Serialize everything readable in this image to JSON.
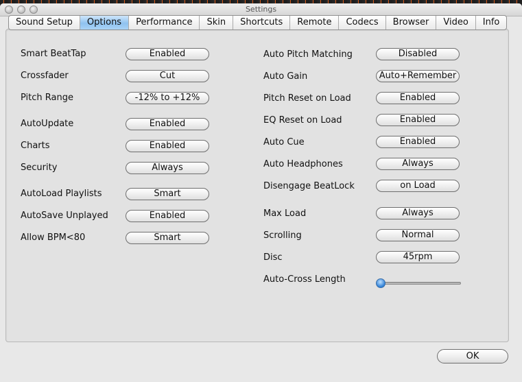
{
  "window": {
    "title": "Settings"
  },
  "tabs": [
    {
      "label": "Sound Setup",
      "active": false
    },
    {
      "label": "Options",
      "active": true
    },
    {
      "label": "Performance",
      "active": false
    },
    {
      "label": "Skin",
      "active": false
    },
    {
      "label": "Shortcuts",
      "active": false
    },
    {
      "label": "Remote",
      "active": false
    },
    {
      "label": "Codecs",
      "active": false
    },
    {
      "label": "Browser",
      "active": false
    },
    {
      "label": "Video",
      "active": false
    },
    {
      "label": "Info",
      "active": false
    }
  ],
  "left_options": [
    {
      "label": "Smart BeatTap",
      "value": "Enabled"
    },
    {
      "label": "Crossfader",
      "value": "Cut"
    },
    {
      "label": "Pitch Range",
      "value": "-12% to +12%"
    },
    {
      "label": "AutoUpdate",
      "value": "Enabled"
    },
    {
      "label": "Charts",
      "value": "Enabled"
    },
    {
      "label": "Security",
      "value": "Always"
    },
    {
      "label": "AutoLoad Playlists",
      "value": "Smart"
    },
    {
      "label": "AutoSave Unplayed",
      "value": "Enabled"
    },
    {
      "label": "Allow BPM<80",
      "value": "Smart"
    }
  ],
  "right_options": [
    {
      "label": "Auto Pitch Matching",
      "value": "Disabled"
    },
    {
      "label": "Auto Gain",
      "value": "Auto+Remember"
    },
    {
      "label": "Pitch Reset on Load",
      "value": "Enabled"
    },
    {
      "label": "EQ Reset on Load",
      "value": "Enabled"
    },
    {
      "label": "Auto Cue",
      "value": "Enabled"
    },
    {
      "label": "Auto Headphones",
      "value": "Always"
    },
    {
      "label": "Disengage BeatLock",
      "value": "on Load"
    },
    {
      "label": "Max Load",
      "value": "Always"
    },
    {
      "label": "Scrolling",
      "value": "Normal"
    },
    {
      "label": "Disc",
      "value": "45rpm"
    }
  ],
  "slider": {
    "label": "Auto-Cross Length",
    "value_fraction": 0.0
  },
  "footer": {
    "ok_label": "OK"
  },
  "colors": {
    "active_tab": "#8fc2f0",
    "slider_knob": "#2e7fd6"
  }
}
